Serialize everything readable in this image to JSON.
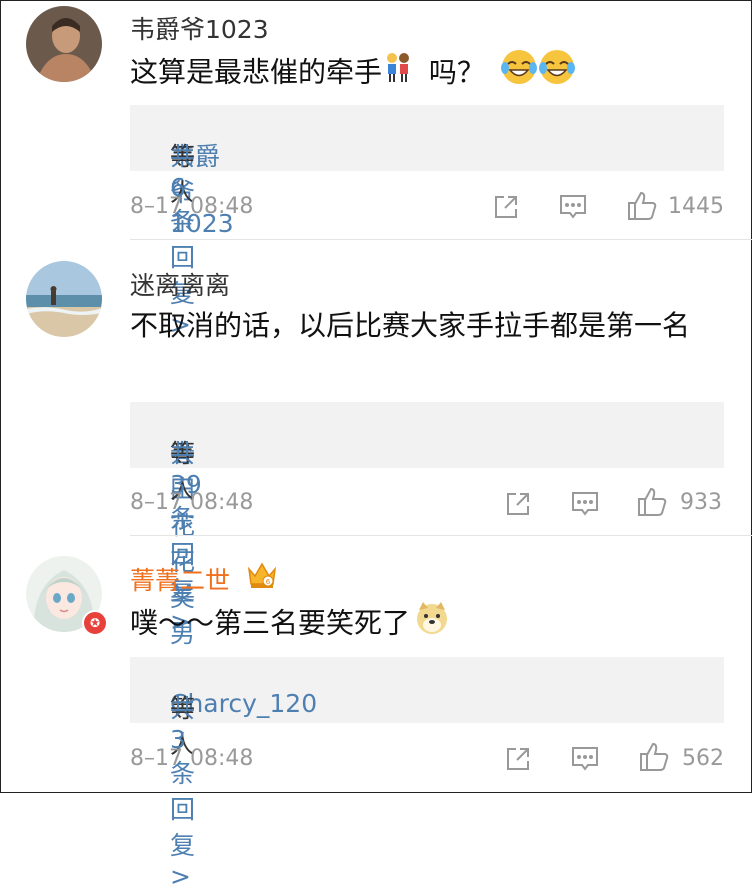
{
  "comments": [
    {
      "username": "韦爵爷1023",
      "text": "这算是最悲催的牵手",
      "text_suffix": "吗？",
      "reply_users": "韦爵爷1023",
      "reply_mid": "等人",
      "reply_count": "共6条回复 >",
      "time": "8–17 08:48",
      "likes": "1445"
    },
    {
      "username": "迷离离离",
      "text": "不取消的话，以后比赛大家手拉手都是第一名",
      "reply_users": "春田花花美男子",
      "reply_mid": "等人",
      "reply_count": "共39条回复 >",
      "time": "8–17 08:48",
      "likes": "933"
    },
    {
      "username": "菁菁二世",
      "text": "噗～～第三名要笑死了",
      "reply_users": "Charcy_120",
      "reply_mid": "等人",
      "reply_count": "共3条回复 >",
      "time": "8–17 08:48",
      "likes": "562"
    }
  ],
  "colors": {
    "link": "#4e7fb1",
    "vip_name": "#f0701e",
    "meta": "#999999"
  }
}
